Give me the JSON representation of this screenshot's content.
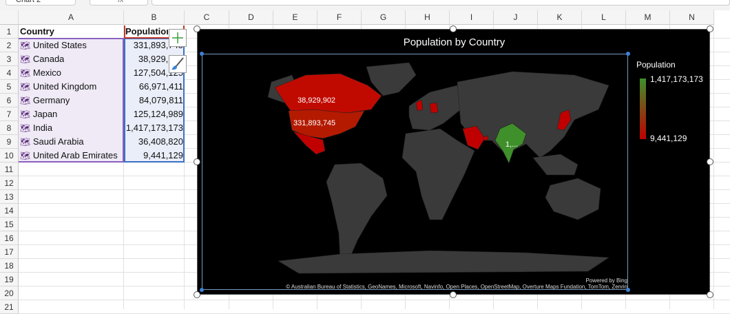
{
  "formula_bar": {
    "name_box": "Chart 2",
    "fx_label": "fx"
  },
  "columns": [
    "A",
    "B",
    "C",
    "D",
    "E",
    "F",
    "G",
    "H",
    "I",
    "J",
    "K",
    "L",
    "M",
    "N"
  ],
  "rows": [
    "1",
    "2",
    "3",
    "4",
    "5",
    "6",
    "7",
    "8",
    "9",
    "10",
    "11",
    "12",
    "13",
    "14",
    "15",
    "16",
    "17",
    "18",
    "19",
    "20",
    "21"
  ],
  "table": {
    "headers": [
      "Country",
      "Population"
    ],
    "rows": [
      {
        "country": "United States",
        "population": "331,893,745"
      },
      {
        "country": "Canada",
        "population": "38,929,902"
      },
      {
        "country": "Mexico",
        "population": "127,504,125"
      },
      {
        "country": "United Kingdom",
        "population": "66,971,411"
      },
      {
        "country": "Germany",
        "population": "84,079,811"
      },
      {
        "country": "Japan",
        "population": "125,124,989"
      },
      {
        "country": "India",
        "population": "1,417,173,173"
      },
      {
        "country": "Saudi Arabia",
        "population": "36,408,820"
      },
      {
        "country": "United Arab Emirates",
        "population": "9,441,129"
      }
    ],
    "row_icon": "geography-map-icon"
  },
  "chart": {
    "title": "Population by Country",
    "type": "filled-map",
    "data_labels": {
      "canada": "38,929,902",
      "united_states": "331,893,745",
      "india": "1,..."
    },
    "legend": {
      "title": "Population",
      "max": "1,417,173,173",
      "min": "9,441,129",
      "max_color": "#3f8f2a",
      "min_color": "#c00000"
    },
    "credits": {
      "powered": "Powered by Bing",
      "sources": "© Australian Bureau of Statistics, GeoNames, Microsoft, Navinfo, Open Places, OpenStreetMap, Overture Maps Fundation, TomTom, Zenrin"
    },
    "colors": {
      "land": "#3a3a3a",
      "background": "#000000"
    }
  },
  "side_buttons": [
    "chart-elements-icon",
    "chart-styles-icon"
  ]
}
